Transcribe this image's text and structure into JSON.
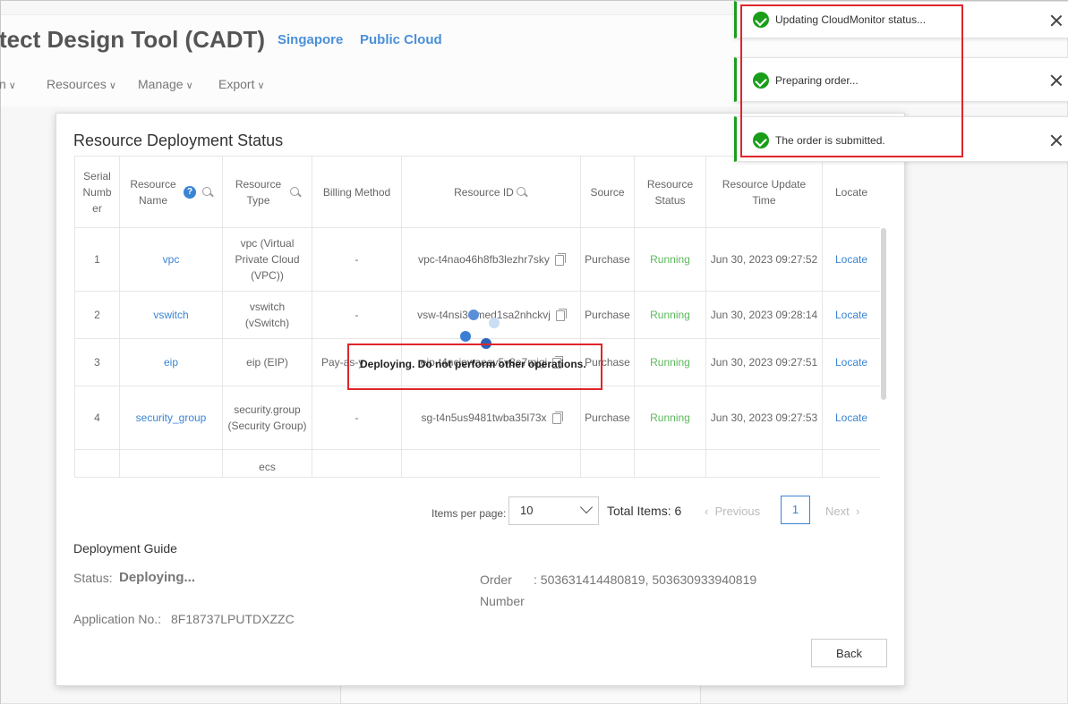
{
  "app": {
    "title": "tect Design Tool (CADT)",
    "region": "Singapore",
    "cloud": "Public Cloud",
    "menu": [
      {
        "label": "n"
      },
      {
        "label": "Resources"
      },
      {
        "label": "Manage"
      },
      {
        "label": "Export"
      }
    ]
  },
  "modal": {
    "title": "Resource Deployment Status",
    "columns": {
      "serial": "Serial Number",
      "name": "Resource Name",
      "type": "Resource Type",
      "billing": "Billing Method",
      "id": "Resource ID",
      "source": "Source",
      "status": "Resource Status",
      "update": "Resource Update Time",
      "locate": "Locate"
    },
    "rows": [
      {
        "num": "1",
        "name": "vpc",
        "type": "vpc (Virtual Private Cloud (VPC))",
        "billing": "-",
        "id": "vpc-t4nao46h8fb3lezhr7sky",
        "source": "Purchase",
        "status": "Running",
        "time": "Jun 30, 2023 09:27:52",
        "locate": "Locate"
      },
      {
        "num": "2",
        "name": "vswitch",
        "type": "vswitch (vSwitch)",
        "billing": "-",
        "id": "vsw-t4nsi3cimed1sa2nhckvj",
        "source": "Purchase",
        "status": "Running",
        "time": "Jun 30, 2023 09:28:14",
        "locate": "Locate"
      },
      {
        "num": "3",
        "name": "eip",
        "type": "eip (EIP)",
        "billing": "Pay-as-y",
        "id": "eip-t4ncjowaeav5v8e7mjgi",
        "source": "Purchase",
        "status": "Running",
        "time": "Jun 30, 2023 09:27:51",
        "locate": "Locate"
      },
      {
        "num": "4",
        "name": "security_group",
        "type": "security.group (Security Group)",
        "billing": "-",
        "id": "sg-t4n5us9481twba35l73x",
        "source": "Purchase",
        "status": "Running",
        "time": "Jun 30, 2023 09:27:53",
        "locate": "Locate"
      },
      {
        "num": "",
        "name": "",
        "type": "ecs",
        "billing": "",
        "id": "",
        "source": "",
        "status": "",
        "time": "",
        "locate": ""
      }
    ],
    "pagination": {
      "items_per_page_label": "Items per page:",
      "page_size": "10",
      "total": "Total Items: 6",
      "previous": "Previous",
      "current_page": "1",
      "next": "Next"
    },
    "guide": {
      "title": "Deployment Guide",
      "status_label": "Status:",
      "status_value": "Deploying...",
      "order_label": "Order Number",
      "order_value": ": 503631414480819,  503630933940819",
      "app_label": "Application No.:",
      "app_value": "8F18737LPUTDXZZC"
    },
    "back_label": "Back"
  },
  "loading": {
    "text": "Deploying. Do not perform other operations."
  },
  "notifications": [
    {
      "text": "Updating CloudMonitor status..."
    },
    {
      "text": "Preparing order..."
    },
    {
      "text": "The order is submitted."
    }
  ],
  "colors": {
    "accent": "#3a84d4",
    "running": "#5cb85c",
    "success": "#1a9e1a",
    "highlight": "#e0252b"
  }
}
